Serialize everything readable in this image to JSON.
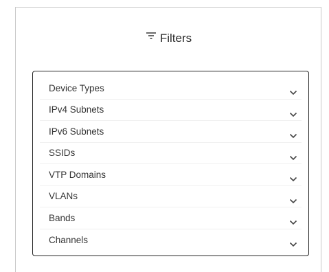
{
  "header": {
    "title": "Filters",
    "icon": "filter-icon"
  },
  "filters": [
    {
      "label": "Device Types",
      "icon": "chevron-down-icon"
    },
    {
      "label": "IPv4 Subnets",
      "icon": "chevron-down-icon"
    },
    {
      "label": "IPv6 Subnets",
      "icon": "chevron-down-icon"
    },
    {
      "label": "SSIDs",
      "icon": "chevron-down-icon"
    },
    {
      "label": "VTP Domains",
      "icon": "chevron-down-icon"
    },
    {
      "label": "VLANs",
      "icon": "chevron-down-icon"
    },
    {
      "label": "Bands",
      "icon": "chevron-down-icon"
    },
    {
      "label": "Channels",
      "icon": "chevron-down-icon"
    }
  ],
  "colors": {
    "text": "#333333",
    "border": "#222222",
    "panel_border": "#c9c9c9"
  }
}
